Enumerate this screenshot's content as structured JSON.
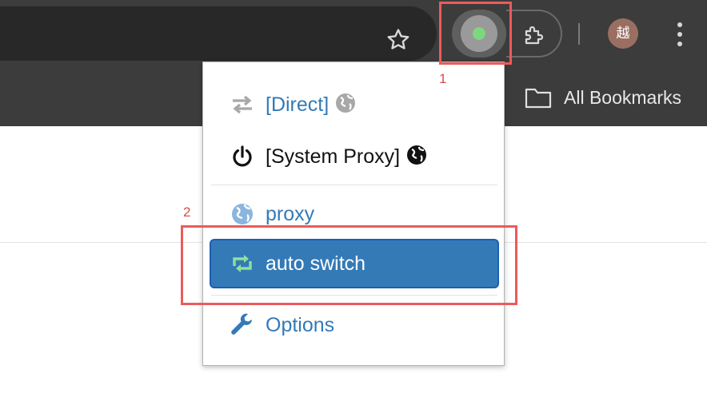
{
  "toolbar": {
    "avatar_text": "越",
    "icons": [
      "star-icon",
      "proxy-extension-icon",
      "extensions-puzzle-icon",
      "more-menu-icon"
    ]
  },
  "bookmarks": {
    "all_bookmarks_label": "All Bookmarks"
  },
  "popup": {
    "items": [
      {
        "label": "[Direct]",
        "icon": "direct-arrows-icon",
        "color": "#337ab7"
      },
      {
        "label": "[System Proxy]",
        "icon": "power-icon",
        "color": "#111111"
      },
      {
        "label": "proxy",
        "icon": "globe-icon",
        "color": "#337ab7"
      },
      {
        "label": "auto switch",
        "icon": "retweet-icon",
        "color": "#ffffff",
        "active": true
      },
      {
        "label": "Options",
        "icon": "wrench-icon",
        "color": "#337ab7"
      }
    ]
  },
  "annotations": {
    "marker_1": "1",
    "marker_2": "2"
  },
  "colors": {
    "toolbar_bg": "#3c3c3c",
    "active_bg": "#337ab7",
    "link": "#337ab7",
    "highlight": "#eb5b5b",
    "status_dot": "#7ed67e"
  }
}
